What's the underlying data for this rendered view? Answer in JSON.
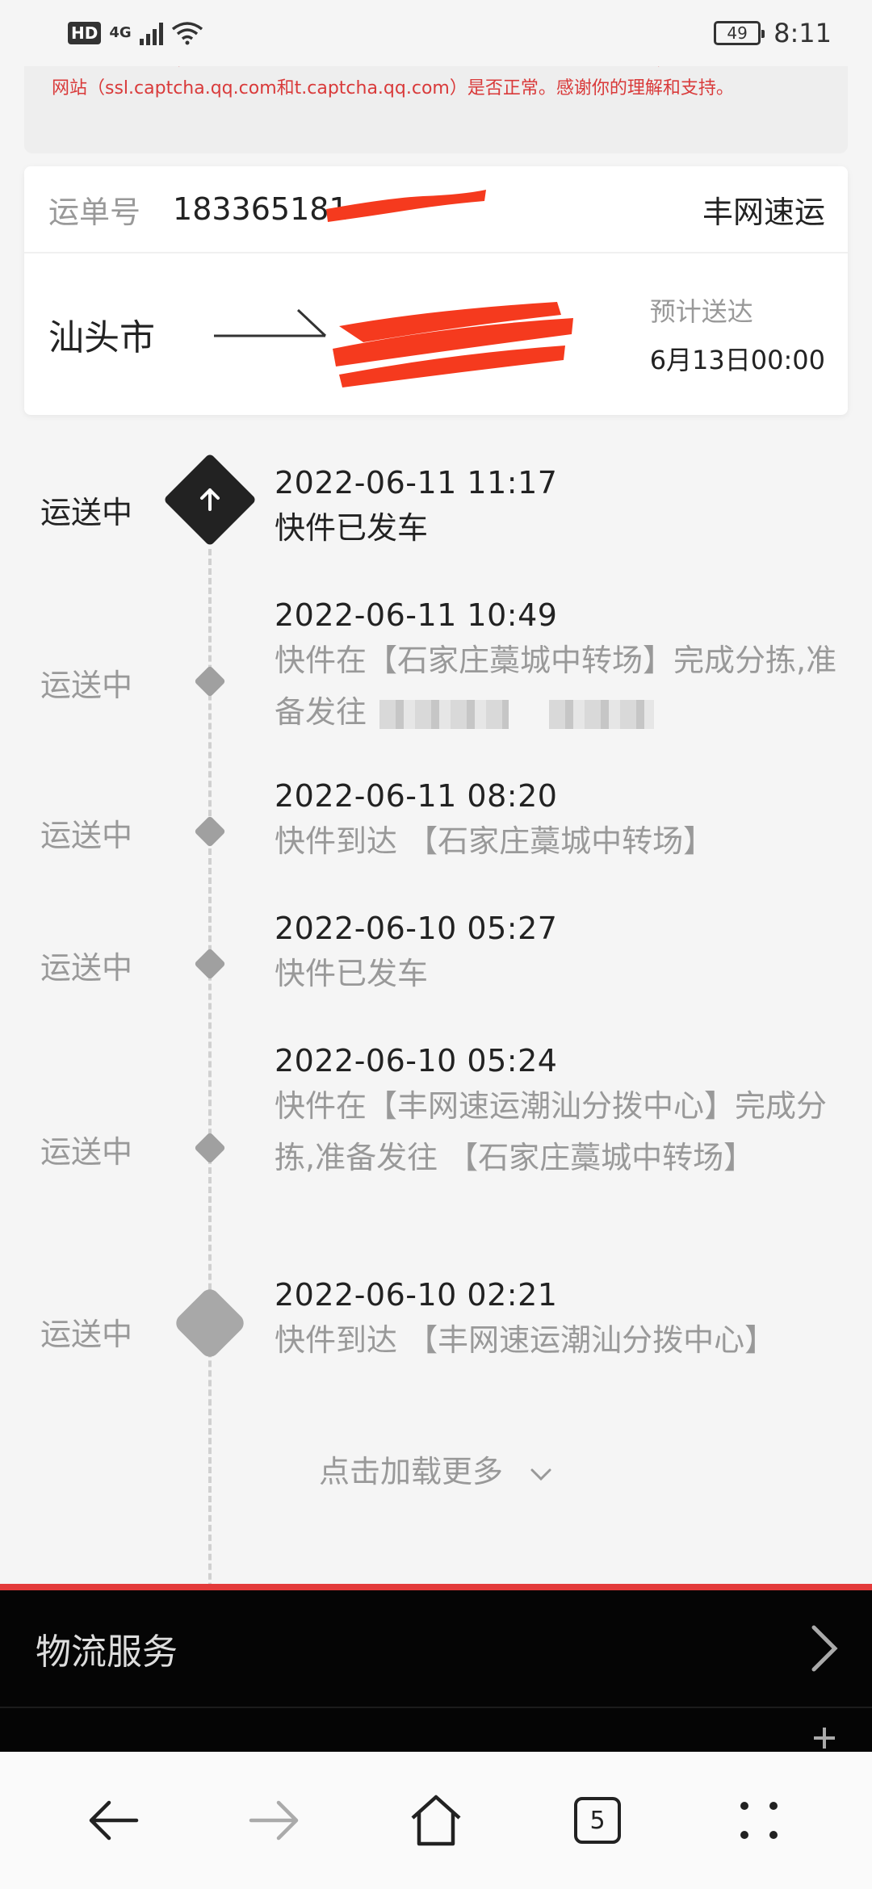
{
  "status_bar": {
    "network_badge": "HD",
    "network_type": "4G",
    "battery": "49",
    "time": "8:11"
  },
  "notice": {
    "text": "为提升用户体验，系统将采用新版腾讯滑块验证码。如果滑块验证码功能异常，请确认访问下面的网站（ssl.captcha.qq.com和t.captcha.qq.com）是否正常。感谢你的理解和支持。"
  },
  "waybill": {
    "label": "运单号",
    "number": "183365181",
    "carrier": "丰网速运",
    "from_city": "汕头市",
    "eta_label": "预计送达",
    "eta_value": "6月13日00:00"
  },
  "timeline": [
    {
      "status": "运送中",
      "time": "2022-06-11 11:17",
      "desc": "快件已发车"
    },
    {
      "status": "运送中",
      "time": "2022-06-11 10:49",
      "desc": "快件在【石家庄藁城中转场】完成分拣,准备发往"
    },
    {
      "status": "运送中",
      "time": "2022-06-11 08:20",
      "desc": "快件到达 【石家庄藁城中转场】"
    },
    {
      "status": "运送中",
      "time": "2022-06-10 05:27",
      "desc": "快件已发车"
    },
    {
      "status": "运送中",
      "time": "2022-06-10 05:24",
      "desc": "快件在【丰网速运潮汕分拨中心】完成分拣,准备发往 【石家庄藁城中转场】"
    },
    {
      "status": "运送中",
      "time": "2022-06-10 02:21",
      "desc": "快件到达 【丰网速运潮汕分拨中心】"
    }
  ],
  "load_more": "点击加载更多",
  "services": {
    "logistics_label": "物流服务"
  },
  "browser_nav": {
    "tab_count": "5"
  }
}
